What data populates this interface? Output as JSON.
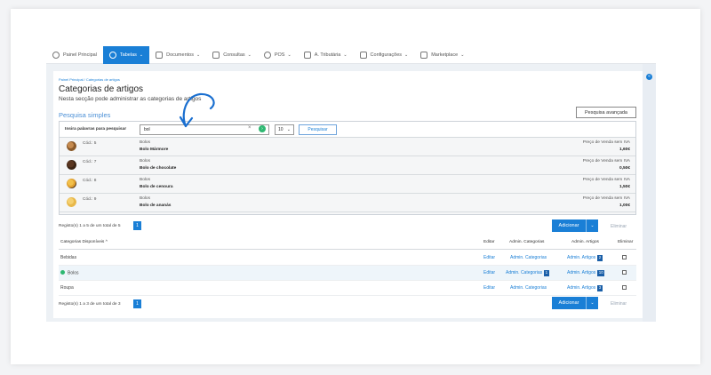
{
  "nav": {
    "items": [
      {
        "label": "Painel Principal",
        "icon": "clock-icon",
        "active": false,
        "caret": false
      },
      {
        "label": "Tabelas",
        "icon": "users-icon",
        "active": true,
        "caret": true
      },
      {
        "label": "Documentos",
        "icon": "document-icon",
        "active": false,
        "caret": true
      },
      {
        "label": "Consultas",
        "icon": "bar-chart-icon",
        "active": false,
        "caret": true
      },
      {
        "label": "POS",
        "icon": "gear-icon",
        "active": false,
        "caret": true
      },
      {
        "label": "A. Tributária",
        "icon": "network-icon",
        "active": false,
        "caret": true
      },
      {
        "label": "Configurações",
        "icon": "sliders-icon",
        "active": false,
        "caret": true
      },
      {
        "label": "Marketplace",
        "icon": "grid-icon",
        "active": false,
        "caret": true
      }
    ]
  },
  "breadcrumb": "Painel Principal  /  Categorias de artigos",
  "page": {
    "title": "Categorias de artigos",
    "subtitle": "Nesta secção pode administrar as categorias de artigos"
  },
  "search": {
    "section_title": "Pesquisa simples",
    "advanced_label": "Pesquisa avançada",
    "label": "Insira palavras para pesquisar",
    "value": "bol",
    "clear_symbol": "×",
    "count_value": "10",
    "button_label": "Pesquisar"
  },
  "results": [
    {
      "code": "Cód.: 5",
      "category": "Bolos",
      "name": "Bolo Mármore",
      "price_label": "Preço de Venda sem IVA",
      "price": "1,60€",
      "thumb_color": "#8a5a2b"
    },
    {
      "code": "Cód.: 7",
      "category": "Bolos",
      "name": "Bolo de chocolate",
      "price_label": "Preço de Venda sem IVA",
      "price": "0,50€",
      "thumb_color": "#3b2414"
    },
    {
      "code": "Cód.: 8",
      "category": "Bolos",
      "name": "Bolo de cenoura",
      "price_label": "Preço de Venda sem IVA",
      "price": "1,50€",
      "thumb_color": "#e0a030"
    },
    {
      "code": "Cód.: 9",
      "category": "Bolos",
      "name": "Bolo de ananás",
      "price_label": "Preço de Venda sem IVA",
      "price": "1,00€",
      "thumb_color": "#e8b84a"
    }
  ],
  "records_top": "Registo(s) 1 a 5 de um total de 5",
  "records_bottom": "Registo(s) 1 a 3 de um total de 3",
  "page_number": "1",
  "add_label": "Adicionar",
  "delete_label": "Eliminar",
  "table": {
    "headers": {
      "category": "Categorias Disponíveis ^",
      "edit": "Editar",
      "admin_cat": "Admin. Categorias",
      "admin_art": "Admin. Artigos",
      "delete": "Eliminar"
    },
    "rows": [
      {
        "name": "Bebidas",
        "edit": "Editar",
        "admin_cat": "Admin. Categorias",
        "admin_cat_count": "",
        "admin_art": "Admin. Artigos",
        "admin_art_count": "2",
        "highlight": false
      },
      {
        "name": "Bolos",
        "edit": "Editar",
        "admin_cat": "Admin. Categorias",
        "admin_cat_count": "1",
        "admin_art": "Admin. Artigos",
        "admin_art_count": "10",
        "highlight": true
      },
      {
        "name": "Roupa",
        "edit": "Editar",
        "admin_cat": "Admin. Categorias",
        "admin_cat_count": "",
        "admin_art": "Admin. Artigos",
        "admin_art_count": "3",
        "highlight": false
      }
    ]
  },
  "colors": {
    "accent": "#1a7fd6",
    "success": "#2eb872"
  }
}
